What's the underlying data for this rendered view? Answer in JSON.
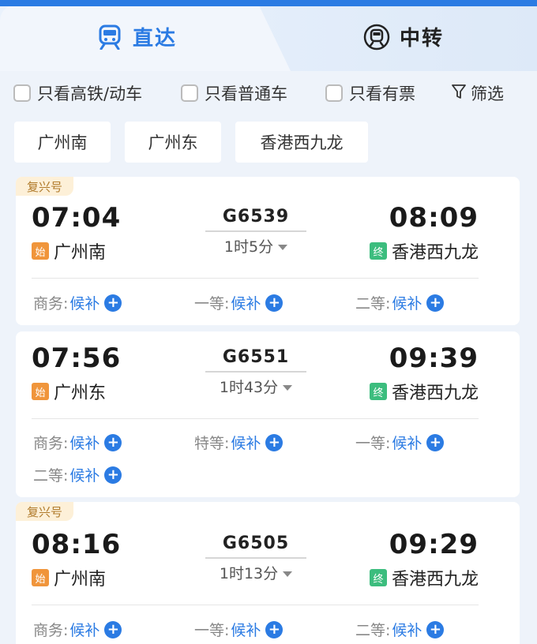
{
  "tabs": {
    "direct": "直达",
    "transfer": "中转"
  },
  "filters": {
    "high_speed_only": "只看高铁/动车",
    "regular_only": "只看普通车",
    "available_only": "只看有票",
    "filter_button": "筛选"
  },
  "stations": [
    "广州南",
    "广州东",
    "香港西九龙"
  ],
  "trains": [
    {
      "badge": "复兴号",
      "dep_time": "07:04",
      "arr_time": "08:09",
      "train_no": "G6539",
      "duration": "1时5分",
      "start_tag": "始",
      "end_tag": "终",
      "dep_station": "广州南",
      "arr_station": "香港西九龙",
      "seats": [
        {
          "cls": "商务:",
          "val": "候补"
        },
        {
          "cls": "一等:",
          "val": "候补"
        },
        {
          "cls": "二等:",
          "val": "候补"
        }
      ]
    },
    {
      "badge": "",
      "dep_time": "07:56",
      "arr_time": "09:39",
      "train_no": "G6551",
      "duration": "1时43分",
      "start_tag": "始",
      "end_tag": "终",
      "dep_station": "广州东",
      "arr_station": "香港西九龙",
      "seats": [
        {
          "cls": "商务:",
          "val": "候补"
        },
        {
          "cls": "特等:",
          "val": "候补"
        },
        {
          "cls": "一等:",
          "val": "候补"
        },
        {
          "cls": "二等:",
          "val": "候补"
        }
      ]
    },
    {
      "badge": "复兴号",
      "dep_time": "08:16",
      "arr_time": "09:29",
      "train_no": "G6505",
      "duration": "1时13分",
      "start_tag": "始",
      "end_tag": "终",
      "dep_station": "广州南",
      "arr_station": "香港西九龙",
      "seats": [
        {
          "cls": "商务:",
          "val": "候补"
        },
        {
          "cls": "一等:",
          "val": "候补"
        },
        {
          "cls": "二等:",
          "val": "候补"
        }
      ]
    }
  ],
  "colors": {
    "accent": "#2b7be3",
    "start_tag": "#f0953b",
    "end_tag": "#3cbd7e",
    "badge_bg": "#fdf0d8",
    "badge_text": "#b07a2a"
  }
}
